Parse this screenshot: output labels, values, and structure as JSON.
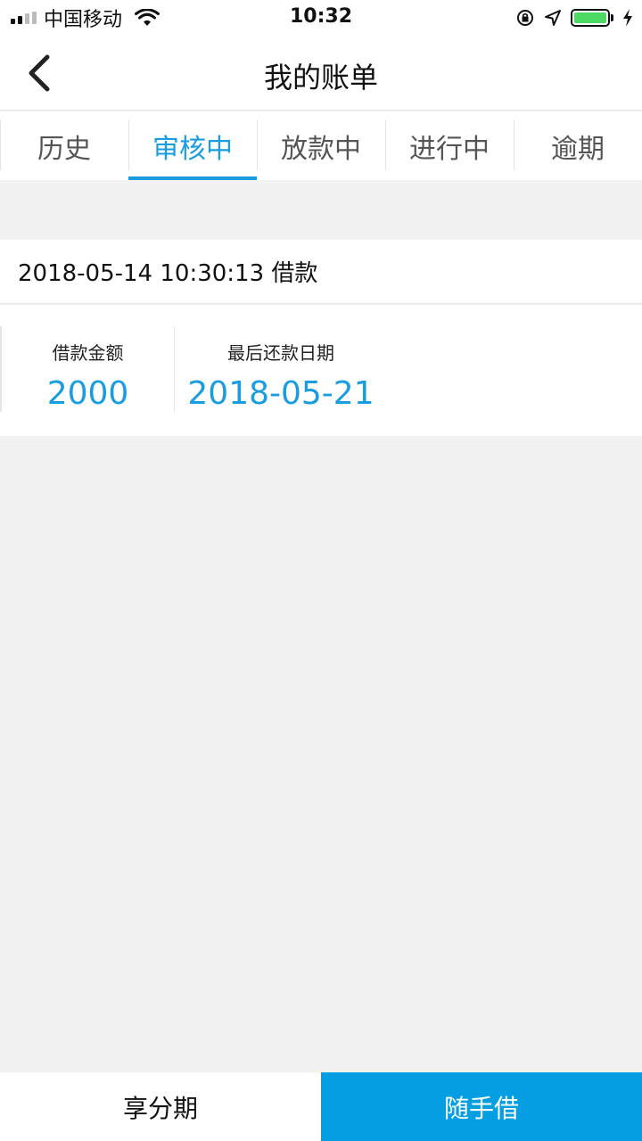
{
  "status_bar": {
    "carrier": "中国移动",
    "time": "10:32"
  },
  "nav": {
    "title": "我的账单"
  },
  "tabs": [
    {
      "label": "历史",
      "active": false
    },
    {
      "label": "审核中",
      "active": true
    },
    {
      "label": "放款中",
      "active": false
    },
    {
      "label": "进行中",
      "active": false
    },
    {
      "label": "逾期",
      "active": false
    }
  ],
  "loan": {
    "header": "2018-05-14 10:30:13 借款",
    "amount_label": "借款金额",
    "amount_value": "2000",
    "due_label": "最后还款日期",
    "due_value": "2018-05-21"
  },
  "bottom": {
    "installment_label": "享分期",
    "borrow_label": "随手借"
  },
  "colors": {
    "accent": "#1a9de0",
    "borrow_button": "#069ee3",
    "background": "#f1f1f1"
  }
}
